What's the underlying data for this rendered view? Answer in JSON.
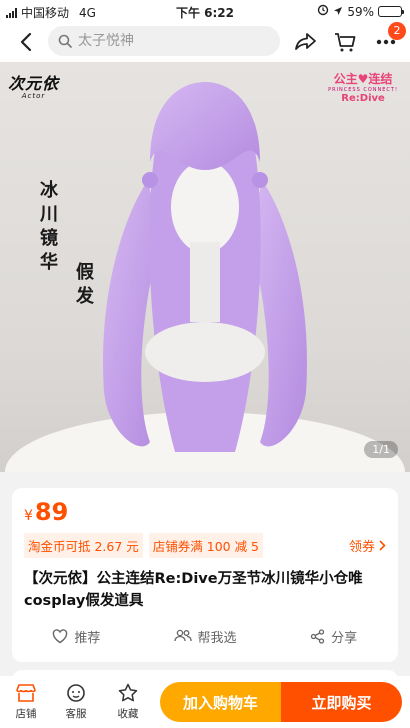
{
  "status_bar": {
    "carrier": "中国移动",
    "network": "4G",
    "time": "下午 6:22",
    "battery": "59%",
    "battery_level": 0.59
  },
  "nav": {
    "search_placeholder": "太子悦神",
    "cart_badge": "2"
  },
  "gallery": {
    "brand_logo": "次元依",
    "brand_logo_sub": "Actor",
    "game_logo_line1": "公主♥连结",
    "game_logo_line2": "Re:Dive",
    "game_logo_sub": "PRINCESS CONNECT!",
    "caption_left": "冰川镜华",
    "caption_right": "假发",
    "counter": "1/1",
    "wig_color": "#c9a6ea"
  },
  "product": {
    "currency": "¥",
    "price": "89",
    "coupons": [
      "淘金币可抵 2.67 元",
      "店铺券满 100 减 5"
    ],
    "coupon_link": "领券",
    "title": "【次元依】公主连结Re:Dive万圣节冰川镜华小仓唯cosplay假发道具",
    "actions": [
      {
        "label": "推荐",
        "icon": "heart-icon"
      },
      {
        "label": "帮我选",
        "icon": "people-icon"
      },
      {
        "label": "分享",
        "icon": "share-icon"
      }
    ]
  },
  "bottom_bar": {
    "shop": "店铺",
    "service": "客服",
    "favorite": "收藏",
    "add_to_cart": "加入购物车",
    "buy_now": "立即购买"
  },
  "colors": {
    "accent": "#ff5000",
    "cart_button": "#ffa800",
    "coupon_bg": "#fff0e8"
  }
}
